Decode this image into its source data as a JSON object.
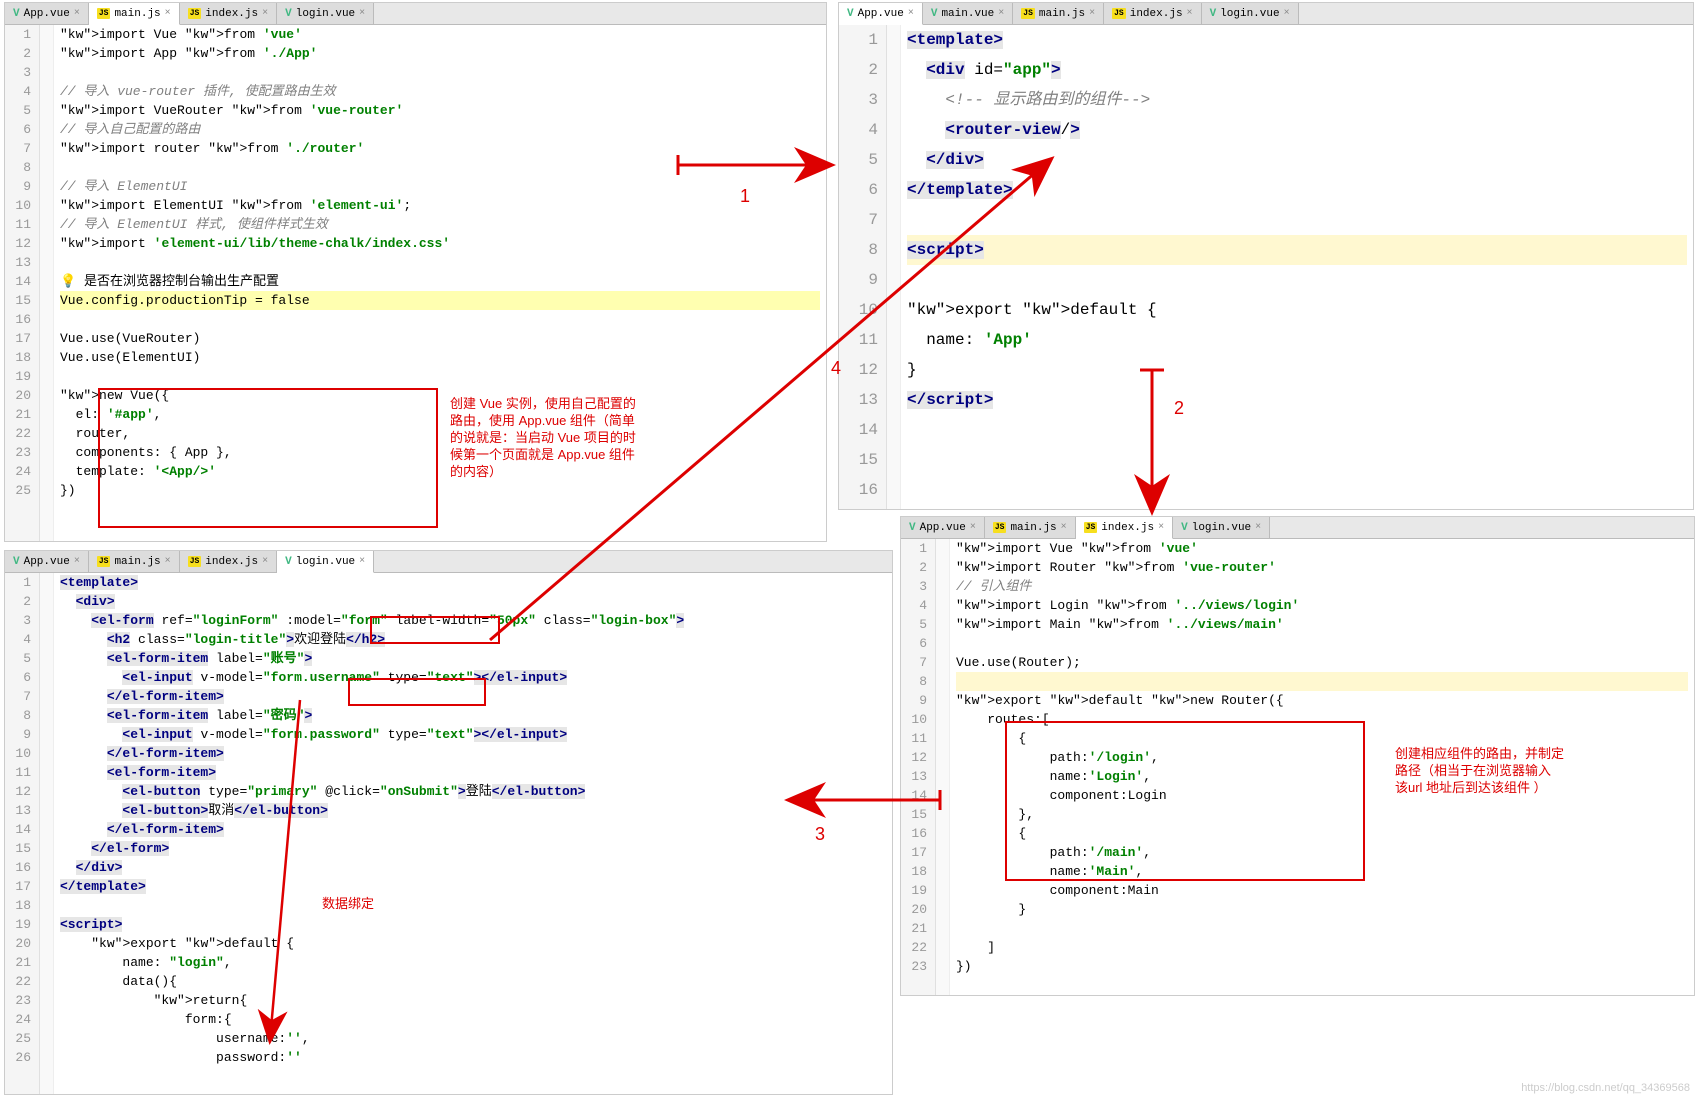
{
  "panel1": {
    "tabs": [
      {
        "icon": "vue",
        "label": "App.vue",
        "active": false
      },
      {
        "icon": "js",
        "label": "main.js",
        "active": true
      },
      {
        "icon": "js",
        "label": "index.js",
        "active": false
      },
      {
        "icon": "vue",
        "label": "login.vue",
        "active": false
      }
    ],
    "lines": [
      "import Vue from 'vue'",
      "import App from './App'",
      "",
      "// 导入 vue-router 插件, 使配置路由生效",
      "import VueRouter from 'vue-router'",
      "// 导入自己配置的路由",
      "import router from './router'",
      "",
      "// 导入 ElementUI",
      "import ElementUI from 'element-ui';",
      "// 导入 ElementUI 样式, 使组件样式生效",
      "import 'element-ui/lib/theme-chalk/index.css'",
      "",
      "💡 是否在浏览器控制台输出生产配置",
      "Vue.config.productionTip = false",
      "",
      "Vue.use(VueRouter)",
      "Vue.use(ElementUI)",
      "",
      "new Vue({",
      "  el: '#app',",
      "  router,",
      "  components: { App },",
      "  template: '<App/>'",
      "})"
    ]
  },
  "panel2": {
    "tabs": [
      {
        "icon": "vue",
        "label": "App.vue",
        "active": true
      },
      {
        "icon": "vue",
        "label": "main.vue",
        "active": false
      },
      {
        "icon": "js",
        "label": "main.js",
        "active": false
      },
      {
        "icon": "js",
        "label": "index.js",
        "active": false
      },
      {
        "icon": "vue",
        "label": "login.vue",
        "active": false
      }
    ],
    "lines": [
      "<template>",
      "  <div id=\"app\">",
      "    <!-- 显示路由到的组件-->",
      "    <router-view/>",
      "  </div>",
      "</template>",
      "",
      "<script>",
      "",
      "export default {",
      "  name: 'App'",
      "}",
      "</script>",
      "",
      "",
      ""
    ]
  },
  "panel3": {
    "tabs": [
      {
        "icon": "vue",
        "label": "App.vue",
        "active": false
      },
      {
        "icon": "js",
        "label": "main.js",
        "active": false
      },
      {
        "icon": "js",
        "label": "index.js",
        "active": false
      },
      {
        "icon": "vue",
        "label": "login.vue",
        "active": true
      }
    ],
    "lines": [
      "<template>",
      "  <div>",
      "    <el-form ref=\"loginForm\" :model=\"form\" label-width=\"50px\" class=\"login-box\">",
      "      <h2 class=\"login-title\">欢迎登陆</h2>",
      "      <el-form-item label=\"账号\">",
      "        <el-input v-model=\"form.username\" type=\"text\"></el-input>",
      "      </el-form-item>",
      "      <el-form-item label=\"密码\">",
      "        <el-input v-model=\"form.password\" type=\"text\"></el-input>",
      "      </el-form-item>",
      "      <el-form-item>",
      "        <el-button type=\"primary\" @click=\"onSubmit\">登陆</el-button>",
      "        <el-button>取消</el-button>",
      "      </el-form-item>",
      "    </el-form>",
      "  </div>",
      "</template>",
      "",
      "<script>",
      "    export default {",
      "        name: \"login\",",
      "        data(){",
      "            return{",
      "                form:{",
      "                    username:'',",
      "                    password:''"
    ]
  },
  "panel4": {
    "tabs": [
      {
        "icon": "vue",
        "label": "App.vue",
        "active": false
      },
      {
        "icon": "js",
        "label": "main.js",
        "active": false
      },
      {
        "icon": "js",
        "label": "index.js",
        "active": true
      },
      {
        "icon": "vue",
        "label": "login.vue",
        "active": false
      }
    ],
    "lines": [
      "import Vue from 'vue'",
      "import Router from 'vue-router'",
      "// 引入组件",
      "import Login from '../views/login'",
      "import Main from '../views/main'",
      "",
      "Vue.use(Router);",
      "",
      "export default new Router({",
      "    routes:[",
      "        {",
      "            path:'/login',",
      "            name:'Login',",
      "            component:Login",
      "        },",
      "        {",
      "            path:'/main',",
      "            name:'Main',",
      "            component:Main",
      "        }",
      "",
      "    ]",
      "})"
    ]
  },
  "annotations": {
    "a1_num": "1",
    "a2_num": "2",
    "a3_num": "3",
    "a4_num": "4",
    "note1": "创建 Vue 实例，使用自己配置的\n路由，使用 App.vue 组件（简单\n的说就是：当启动 Vue 项目的时\n候第一个页面就是 App.vue 组件\n的内容）",
    "note2": "数据绑定",
    "note3": "创建相应组件的路由，并制定\n路径（相当于在浏览器输入\n该url 地址后到达该组件 ）"
  },
  "watermark": "https://blog.csdn.net/qq_34369568"
}
